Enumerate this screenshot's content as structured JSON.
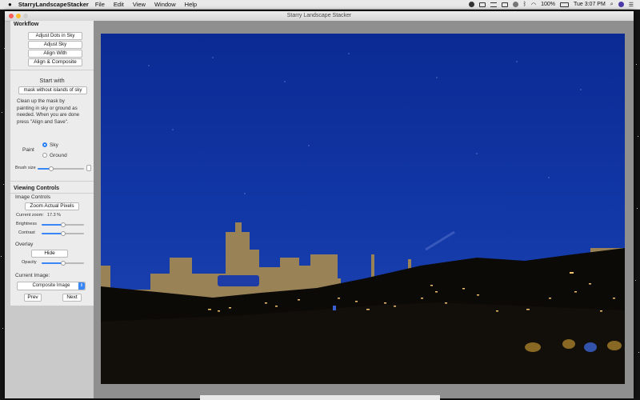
{
  "menubar": {
    "apple": "",
    "app_name": "StarryLandscapeStacker",
    "items": [
      "File",
      "Edit",
      "View",
      "Window",
      "Help"
    ],
    "battery": "100%",
    "clock": "Tue 3:07 PM"
  },
  "window": {
    "title": "Starry Landscape Stacker"
  },
  "workflow": {
    "title": "Workflow",
    "buttons": [
      "Adjust Dots in Sky",
      "Adjust Sky",
      "Align With",
      "Align & Composite"
    ],
    "start_with_label": "Start with",
    "start_with_value": "mask without islands of sky",
    "instructions": [
      "Clean up the mask by",
      "painting in sky or ground as",
      "needed. When you are done",
      "press \"Align and Save\"."
    ],
    "paint_label": "Paint",
    "paint_options": [
      "Sky",
      "Ground"
    ],
    "paint_selected": "Sky",
    "brush_size_label": "Brush size",
    "brush_size": 0.3
  },
  "viewing": {
    "title": "Viewing Controls",
    "image_controls_label": "Image Controls",
    "zoom_button": "Zoom Actual Pixels",
    "current_zoom_label": "Current zoom:",
    "current_zoom_value": "17.3",
    "current_zoom_unit": "%",
    "brightness_label": "Brightness",
    "brightness": 0.5,
    "contrast_label": "Contrast",
    "contrast": 0.5,
    "overlay_label": "Overlay",
    "hide_button": "Hide",
    "opacity_label": "Opacity",
    "opacity": 0.5,
    "current_image_label": "Current Image:",
    "current_image_value": "Composite Image",
    "prev_button": "Prev",
    "next_button": "Next"
  },
  "colors": {
    "sky": "#0e2f9c",
    "mask_overlay": "#9a8257",
    "accent": "#3b86f5"
  }
}
